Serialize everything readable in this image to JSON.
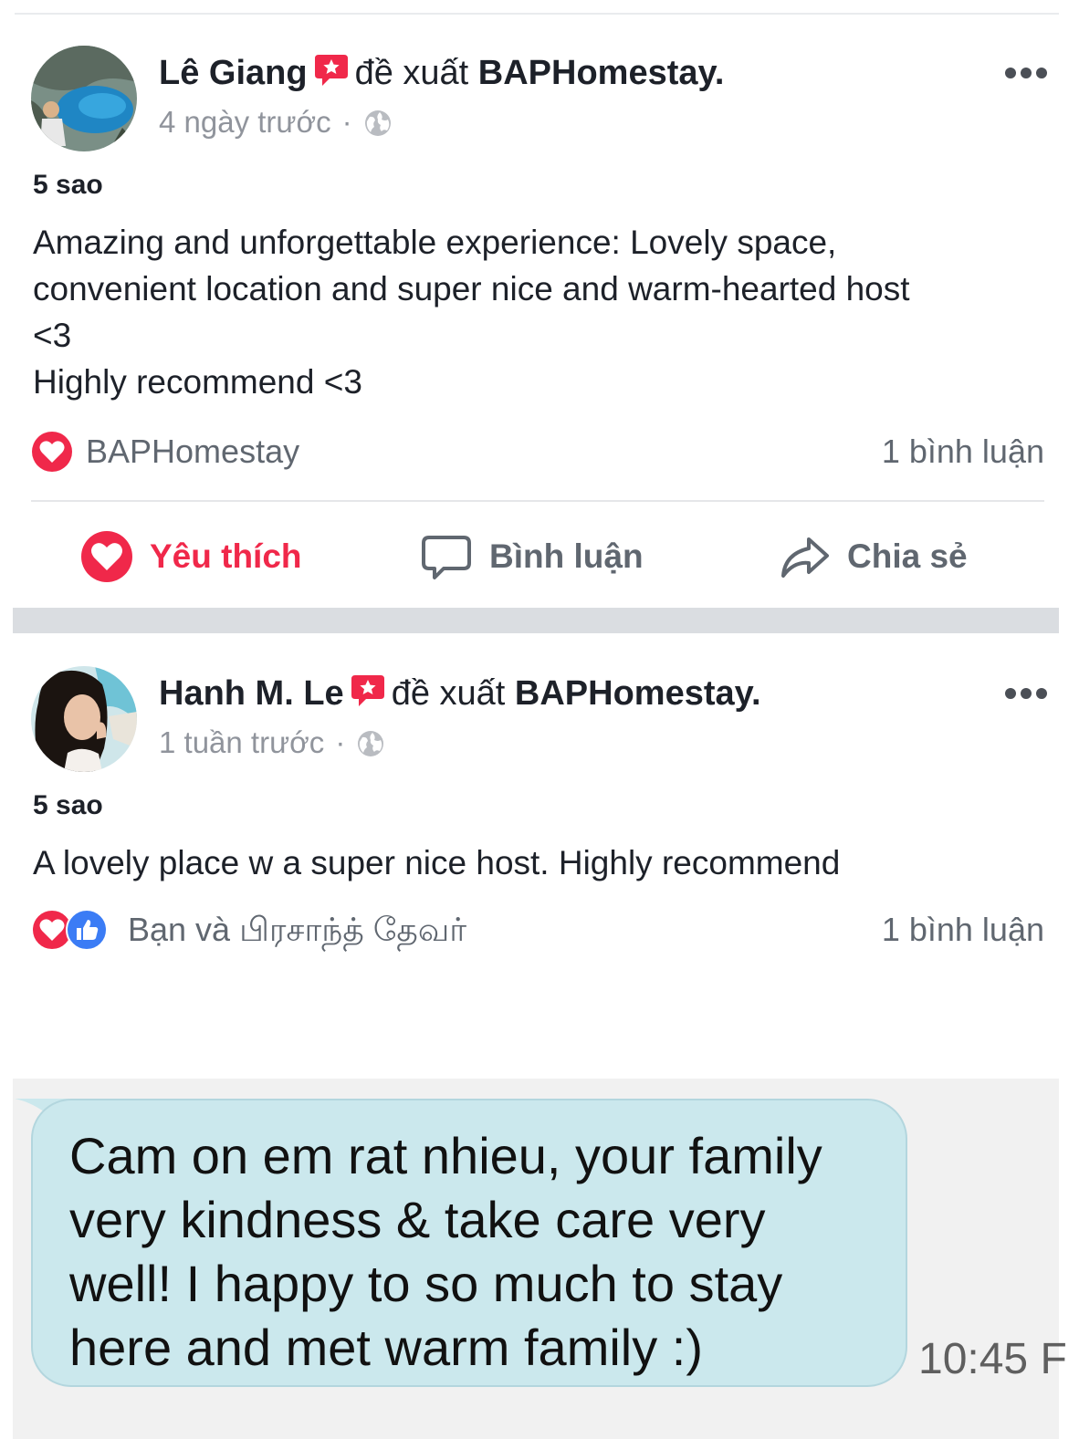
{
  "posts": [
    {
      "author": "Lê Giang",
      "action": "đề xuất",
      "page": "BAPHomestay.",
      "time": "4 ngày trước",
      "dot": "·",
      "rating": "5 sao",
      "text": "Amazing and unforgettable experience: Lovely space,\nconvenient location and super nice and warm-hearted host\n<3\nHighly recommend <3",
      "reactors": "BAPHomestay",
      "comments": "1 bình luận",
      "icons": [
        "avatar",
        "recommend-badge-icon",
        "globe-icon",
        "more-options-icon",
        "heart-reaction-icon"
      ]
    },
    {
      "author": "Hanh M. Le",
      "action": "đề xuất",
      "page": "BAPHomestay.",
      "time": "1 tuần trước",
      "dot": "·",
      "rating": "5 sao",
      "text": "A lovely place w a super nice host. Highly recommend",
      "reactors": "Bạn và பிரசாந்த் தேவர்",
      "comments": "1 bình luận",
      "icons": [
        "avatar",
        "recommend-badge-icon",
        "globe-icon",
        "more-options-icon",
        "heart-reaction-icon",
        "like-reaction-icon"
      ]
    }
  ],
  "actions": {
    "like": "Yêu thích",
    "comment": "Bình luận",
    "share": "Chia sẻ"
  },
  "chat": {
    "message": "Cam on em rat nhieu, your family\nvery kindness & take care very\nwell! I happy to so much to stay\nhere and met warm family :)",
    "time": "10:45 F"
  },
  "colors": {
    "love": "#f0284a",
    "like": "#3b7cf5",
    "muted_text": "#90949c",
    "bubble": "#cbe8ed",
    "separator": "#dadde1"
  }
}
